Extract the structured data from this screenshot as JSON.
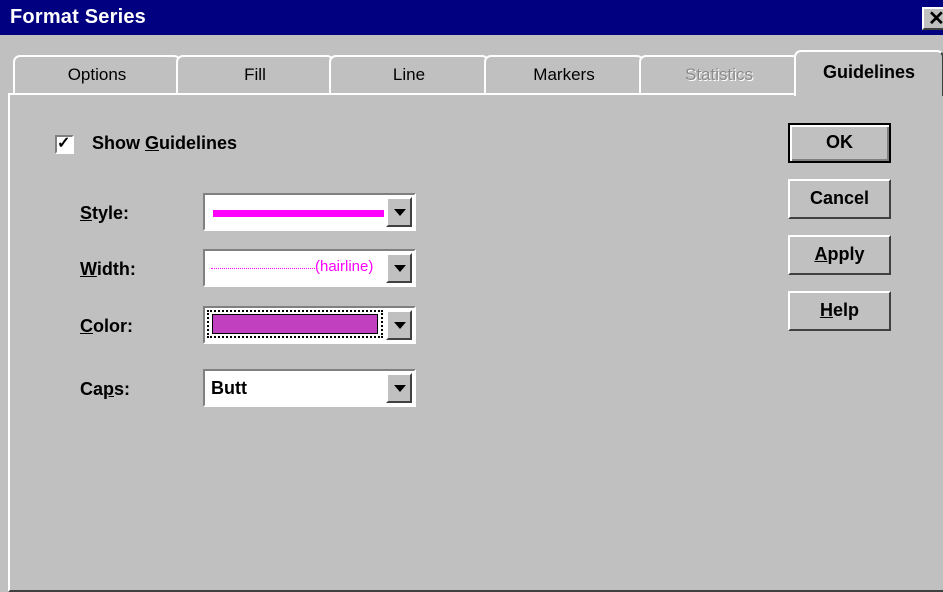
{
  "window": {
    "title": "Format Series"
  },
  "tabs": [
    {
      "label": "Options",
      "state": "normal"
    },
    {
      "label": "Fill",
      "state": "normal"
    },
    {
      "label": "Line",
      "state": "normal"
    },
    {
      "label": "Markers",
      "state": "normal"
    },
    {
      "label": "Statistics",
      "state": "disabled"
    },
    {
      "label": "Guidelines",
      "state": "active"
    }
  ],
  "show_guidelines": {
    "label_pre": "Show ",
    "label_key": "G",
    "label_post": "uidelines",
    "checked": true
  },
  "fields": {
    "style": {
      "label_key": "S",
      "label_post": "tyle:",
      "line_color": "#ff00ff"
    },
    "width": {
      "label_key": "W",
      "label_post": "idth:",
      "value": "(hairline)",
      "line_color": "#ff00ff"
    },
    "color": {
      "label_key": "C",
      "label_post": "olor:",
      "swatch": "#c040c0"
    },
    "caps": {
      "label_pre": "Ca",
      "label_key": "p",
      "label_post": "s:",
      "value": "Butt"
    }
  },
  "buttons": {
    "ok": {
      "label": "OK"
    },
    "cancel": {
      "label": "Cancel"
    },
    "apply": {
      "label_key": "A",
      "label_post": "pply"
    },
    "help": {
      "label_key": "H",
      "label_post": "elp"
    }
  }
}
